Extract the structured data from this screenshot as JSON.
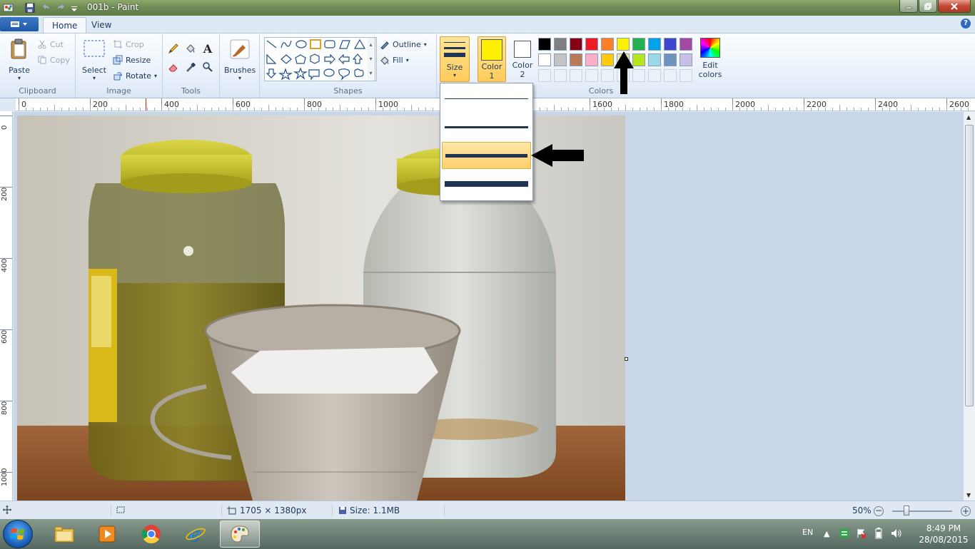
{
  "window": {
    "title": "001b - Paint"
  },
  "tabs": {
    "home": "Home",
    "view": "View"
  },
  "ribbon": {
    "clipboard": {
      "label": "Clipboard",
      "paste": "Paste",
      "cut": "Cut",
      "copy": "Copy"
    },
    "image": {
      "label": "Image",
      "select": "Select",
      "crop": "Crop",
      "resize": "Resize",
      "rotate": "Rotate"
    },
    "tools": {
      "label": "Tools"
    },
    "brushes": {
      "label": "Brushes"
    },
    "shapes": {
      "label": "Shapes",
      "outline": "Outline",
      "fill": "Fill"
    },
    "size": {
      "label": "Size"
    },
    "colors": {
      "label": "Colors",
      "color1_line1": "Color",
      "color1_line2": "1",
      "color2_line1": "Color",
      "color2_line2": "2",
      "edit_line1": "Edit",
      "edit_line2": "colors",
      "color1_value": "#ffef00",
      "color2_value": "#ffffff",
      "palette_row1": [
        "#000000",
        "#7f7f7f",
        "#880015",
        "#ed1c24",
        "#ff7f27",
        "#fff200",
        "#22b14c",
        "#00a2e8",
        "#3f48cc",
        "#a349a4"
      ],
      "palette_row2": [
        "#ffffff",
        "#c3c3c3",
        "#b97a57",
        "#ffaec9",
        "#ffc90e",
        "#efe4b0",
        "#b5e61d",
        "#99d9ea",
        "#7092be",
        "#c8bfe7"
      ]
    }
  },
  "ruler": {
    "h_labels": [
      "0",
      "200",
      "400",
      "600",
      "800",
      "1000",
      "1600",
      "1800",
      "2000",
      "2200",
      "2400",
      "2600"
    ],
    "v_labels": [
      "0",
      "200",
      "400",
      "600",
      "800",
      "1000"
    ]
  },
  "size_dropdown": {
    "options": [
      1,
      3,
      5,
      8
    ],
    "selected_index": 2
  },
  "statusbar": {
    "dimensions": "1705 × 1380px",
    "size": "Size: 1.1MB",
    "zoom": "50%"
  },
  "taskbar": {
    "lang": "EN",
    "time": "8:49 PM",
    "date": "28/08/2015"
  }
}
